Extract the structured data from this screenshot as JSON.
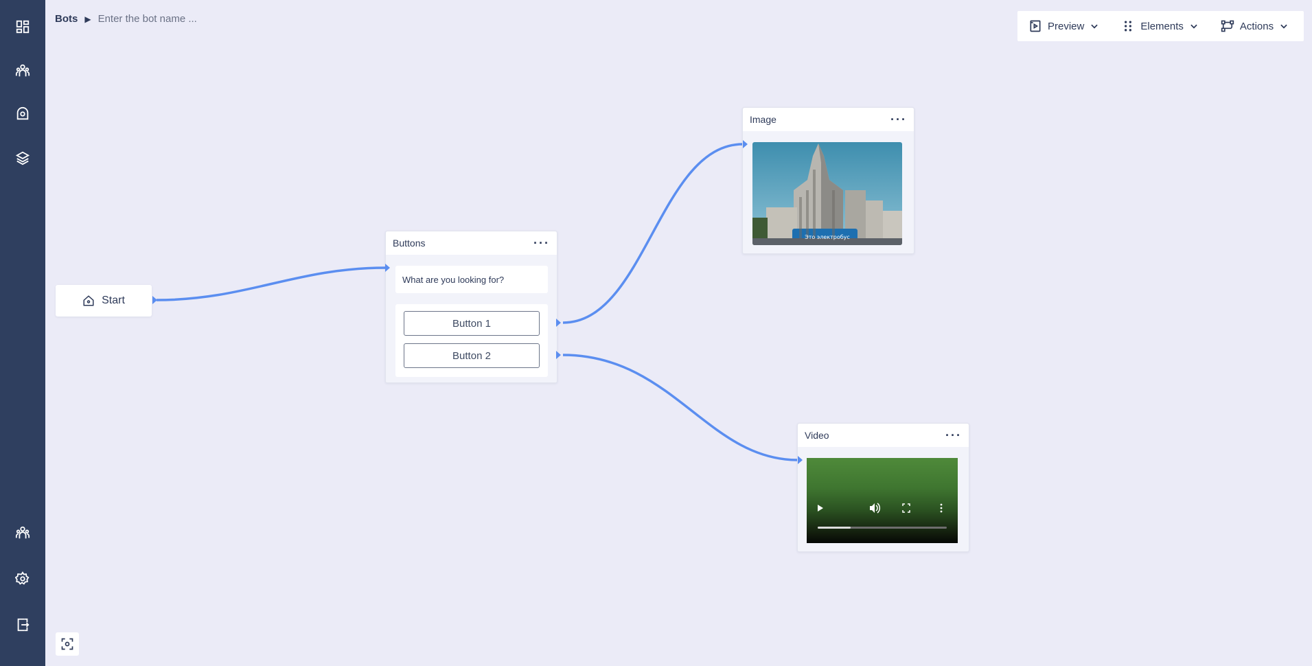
{
  "breadcrumb": {
    "root": "Bots",
    "separator": "›",
    "bot_name_placeholder": "Enter the bot name ..."
  },
  "toolbar": {
    "preview": "Preview",
    "elements": "Elements",
    "actions": "Actions"
  },
  "sidebar": {
    "top_icons": [
      "dashboard-icon",
      "users-icon",
      "broadcast-icon",
      "layers-icon"
    ],
    "bottom_icons": [
      "team-icon",
      "settings-icon",
      "logout-icon"
    ]
  },
  "nodes": {
    "start": {
      "label": "Start"
    },
    "buttons": {
      "title": "Buttons",
      "message": "What are you looking for?",
      "button1": "Button 1",
      "button2": "Button 2"
    },
    "image": {
      "title": "Image",
      "caption": "Это электробус"
    },
    "video": {
      "title": "Video"
    }
  },
  "colors": {
    "sidebar": "#2f3f5f",
    "canvas": "#ebebf7",
    "edge": "#5b8ef0"
  }
}
